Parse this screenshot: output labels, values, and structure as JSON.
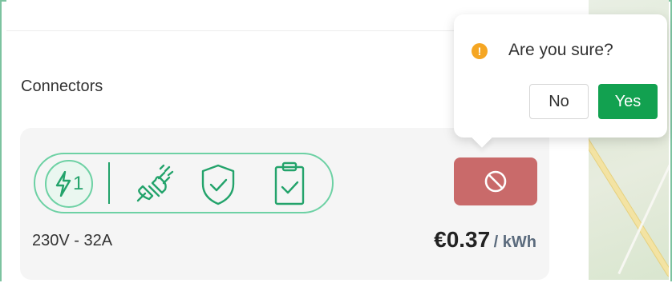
{
  "section": {
    "title": "Connectors"
  },
  "connector": {
    "number": "1",
    "rating": "230V - 32A",
    "price_amount": "€0.37",
    "price_unit": "/ kWh",
    "icons": [
      "bolt-icon",
      "plug-icon",
      "shield-check-icon",
      "clipboard-check-icon",
      "ban-icon"
    ]
  },
  "confirm": {
    "title": "Are you sure?",
    "no_label": "No",
    "yes_label": "Yes",
    "warning_icon": "exclamation-circle-icon"
  },
  "colors": {
    "accent_green": "#23a36b",
    "outline_green": "#6dd1a4",
    "stop_red": "#c96a6a",
    "yes_green": "#12a150",
    "warning_orange": "#f5a623"
  }
}
